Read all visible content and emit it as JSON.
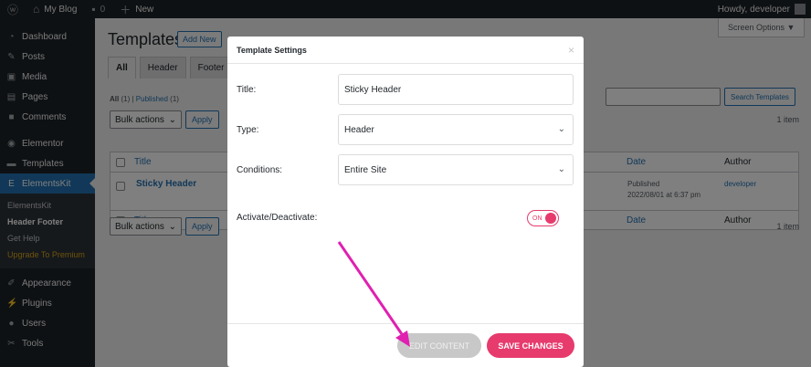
{
  "adminbar": {
    "site": "My Blog",
    "comments": "0",
    "new": "New",
    "howdy": "Howdy, developer"
  },
  "sidebar": {
    "top": [
      {
        "label": "Dashboard",
        "icon": "dashboard-icon",
        "glyph": "◔"
      },
      {
        "label": "Posts",
        "icon": "pin-icon",
        "glyph": "✎"
      },
      {
        "label": "Media",
        "icon": "media-icon",
        "glyph": "▣"
      },
      {
        "label": "Pages",
        "icon": "pages-icon",
        "glyph": "▤"
      },
      {
        "label": "Comments",
        "icon": "comment-icon",
        "glyph": "■"
      },
      {
        "label": "Elementor",
        "icon": "elementor-icon",
        "glyph": "◉"
      },
      {
        "label": "Templates",
        "icon": "folder-icon",
        "glyph": "▬"
      }
    ],
    "active": {
      "label": "ElementsKit",
      "icon": "elementskit-icon",
      "glyph": "E"
    },
    "sub": [
      "ElementsKit",
      "Header Footer",
      "Get Help",
      "Upgrade To Premium"
    ],
    "bottom": [
      {
        "label": "Appearance",
        "icon": "brush-icon",
        "glyph": "✐"
      },
      {
        "label": "Plugins",
        "icon": "plug-icon",
        "glyph": "⚡"
      },
      {
        "label": "Users",
        "icon": "user-icon",
        "glyph": "●"
      },
      {
        "label": "Tools",
        "icon": "wrench-icon",
        "glyph": "✂"
      }
    ]
  },
  "page": {
    "title": "Templates",
    "add_new": "Add New",
    "screen_options": "Screen Options ▼",
    "tabs": [
      "All",
      "Header",
      "Footer"
    ],
    "views": {
      "all": "All",
      "all_count": "(1)",
      "sep": "|",
      "published": "Published",
      "published_count": "(1)"
    },
    "bulk": "Bulk actions",
    "apply": "Apply",
    "search_btn": "Search Templates",
    "count": "1 item"
  },
  "table": {
    "col_title": "Title",
    "col_date": "Date",
    "col_author": "Author",
    "rows": [
      {
        "title": "Sticky Header",
        "status": "Published",
        "date": "2022/08/01 at 6:37 pm",
        "author": "developer"
      }
    ]
  },
  "modal": {
    "title": "Template Settings",
    "close": "×",
    "title_label": "Title:",
    "title_value": "Sticky Header",
    "type_label": "Type:",
    "type_value": "Header",
    "cond_label": "Conditions:",
    "cond_value": "Entire Site",
    "activate_label": "Activate/Deactivate:",
    "toggle": "ON",
    "edit": "EDIT CONTENT",
    "save": "SAVE CHANGES"
  },
  "colors": {
    "accent": "#e73b6d",
    "wp_blue": "#2271b1",
    "arrow": "#e020b0"
  }
}
